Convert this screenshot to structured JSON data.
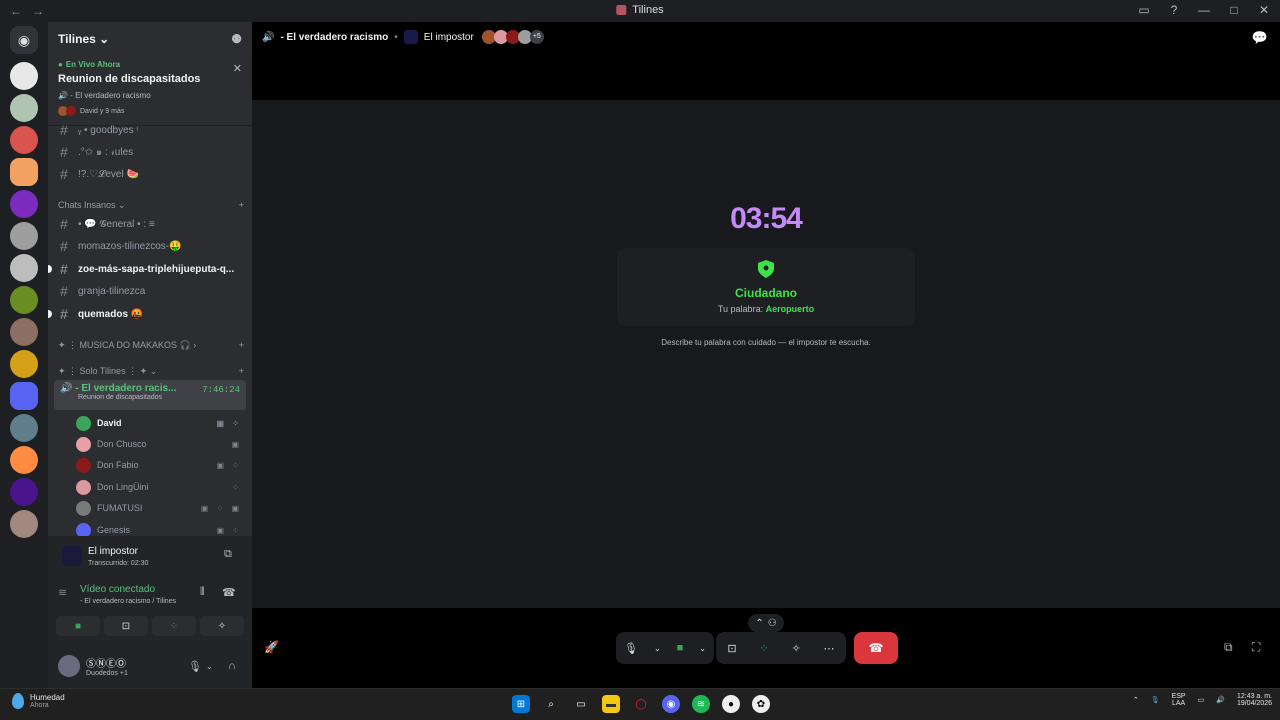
{
  "window": {
    "title": "Tilines",
    "controls": [
      "—",
      "□",
      "✕"
    ]
  },
  "guild": {
    "name": "Tilines ⌄"
  },
  "live": {
    "tag": "En Vivo Ahora",
    "title": "Reunion de discapasitados",
    "channel": "- El verdadero racismo",
    "members": "David y 9 más"
  },
  "channels": [
    {
      "name": "ᵧ • goodbyes ᶦ",
      "unread": false
    },
    {
      "name": ".°✩ ๑ : 𝓇ules",
      "unread": false
    },
    {
      "name": "!?.♡𝓛evel 🍉",
      "unread": false
    }
  ],
  "cat1": {
    "label": "Chats Insanos ⌄"
  },
  "channels2": [
    {
      "name": "• 💬 𝓖eneral • : ≡",
      "unread": false
    },
    {
      "name": "momazos-tilinezcos-🤑",
      "unread": false
    },
    {
      "name": "zoe-más-sapa-triplehijueputa-q...",
      "unread": true
    },
    {
      "name": "granja-tilinezca",
      "unread": false
    },
    {
      "name": "quemados 🤬",
      "unread": true
    }
  ],
  "cat2": {
    "label": "✦ ⋮ MUSICA DO MAKAKOS 🎧 ›"
  },
  "cat3": {
    "label": "✦ ⋮ Solo Tilines ⋮ ✦ ⌄"
  },
  "voice": {
    "name": "- El verdadero racis...",
    "time": "7:46:24",
    "sub": "Reunion de discapasitados"
  },
  "voice_users": [
    {
      "name": "David",
      "bold": true,
      "color": "#3ba55d"
    },
    {
      "name": "Don Chusco",
      "bold": false,
      "color": "#e8a0a8"
    },
    {
      "name": "Don Fabio",
      "bold": false,
      "color": "#8b1a1a"
    },
    {
      "name": "Don LingÜini",
      "bold": false,
      "color": "#d89aa0"
    },
    {
      "name": "FUMATUSI",
      "bold": false,
      "color": "#7a7a7a"
    },
    {
      "name": "Genesis",
      "bold": false,
      "color": "#5865f2"
    }
  ],
  "activity": {
    "title": "El impostor",
    "elapsed": "Transcurrido: 02:30"
  },
  "connection": {
    "status": "Vídeo conectado",
    "channel": "- El verdadero racismo / Tilines"
  },
  "me": {
    "name": "ⓈⓃⒺⓄ",
    "status": "Duodedos +1"
  },
  "call": {
    "channel": "- El verdadero racismo",
    "activity": "El impostor",
    "more_count": "+5"
  },
  "game": {
    "timer": "03:54",
    "role": "Ciudadano",
    "word_label": "Tu palabra:",
    "word": "Aeropuerto",
    "hint": "Describe tu palabra con cuidado — el impostor te escucha.",
    "role_color": "#3ee34a",
    "timer_color": "#c58af9"
  },
  "taskbar": {
    "weather_title": "Humedad",
    "weather_sub": "Ahora",
    "lang1": "ESP",
    "lang2": "LAA",
    "time": "12:43 a. m.",
    "date": "19/04/2026"
  }
}
